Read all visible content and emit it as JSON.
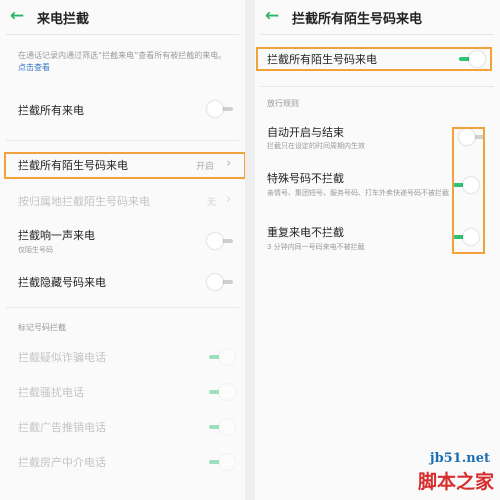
{
  "left": {
    "title": "来电拦截",
    "note": "在通话记录内通过筛选“拦截来电”查看所有被拦截的来电。",
    "note_link": "点击查看",
    "items": {
      "block_all": {
        "label": "拦截所有来电",
        "on": false
      },
      "block_strangers": {
        "label": "拦截所有陌生号码来电",
        "value": "开启"
      },
      "block_non_local": {
        "label": "按归属地拦截陌生号码来电",
        "value": "无"
      },
      "block_one_ring": {
        "label": "拦截响一声来电",
        "sub": "仅陌生号码",
        "on": false
      },
      "block_hidden": {
        "label": "拦截隐藏号码来电",
        "on": false
      }
    },
    "section_title": "标记号码拦截",
    "marked_items": [
      {
        "label": "拦截疑似诈骗电话",
        "on": true
      },
      {
        "label": "拦截骚扰电话",
        "on": true
      },
      {
        "label": "拦截广告推销电话",
        "on": true
      },
      {
        "label": "拦截房产中介电话",
        "on": true
      }
    ]
  },
  "right": {
    "title": "拦截所有陌生号码来电",
    "main_toggle": {
      "label": "拦截所有陌生号码来电",
      "on": true
    },
    "section_title": "放行规则",
    "rules": [
      {
        "label": "自动开启与结束",
        "sub": "拦截只在设定的时间周期内生效",
        "on": false
      },
      {
        "label": "特殊号码不拦截",
        "sub": "亲情号、集团短号、服务号码、打车外卖快递号码不被拦截",
        "on": true
      },
      {
        "label": "重复来电不拦截",
        "sub": "3 分钟内同一号码来电不被拦截",
        "on": true
      }
    ]
  },
  "watermark": {
    "url": "jb51.net",
    "text": "脚本之家"
  },
  "colors": {
    "accent": "#2fc275",
    "highlight": "#f2a23a",
    "back_arrow": "#2db26a",
    "link": "#3478c8"
  },
  "icons": {
    "back": "arrow-left-icon",
    "chevron": "chevron-right-icon"
  }
}
